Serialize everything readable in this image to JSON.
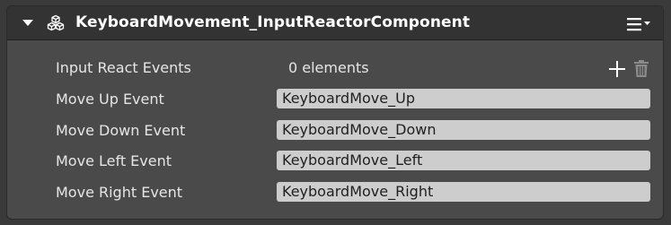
{
  "component": {
    "title": "KeyboardMovement_InputReactorComponent",
    "collapse_icon": "triangle-down-icon",
    "type_icon": "cubes-icon",
    "menu_icon": "hamburger-menu-icon"
  },
  "properties": {
    "input_react_events": {
      "label": "Input React Events",
      "value": "0 elements",
      "add_icon": "plus-icon",
      "remove_icon": "trash-icon"
    },
    "rows": [
      {
        "label": "Move Up Event",
        "value": "KeyboardMove_Up"
      },
      {
        "label": "Move Down Event",
        "value": "KeyboardMove_Down"
      },
      {
        "label": "Move Left Event",
        "value": "KeyboardMove_Left"
      },
      {
        "label": "Move Right Event",
        "value": "KeyboardMove_Right"
      }
    ]
  },
  "colors": {
    "background": "#3a3a3a",
    "panel": "#4a4a4a",
    "header": "#333333",
    "field": "#cdcdcd",
    "text": "#e6e6e6"
  }
}
